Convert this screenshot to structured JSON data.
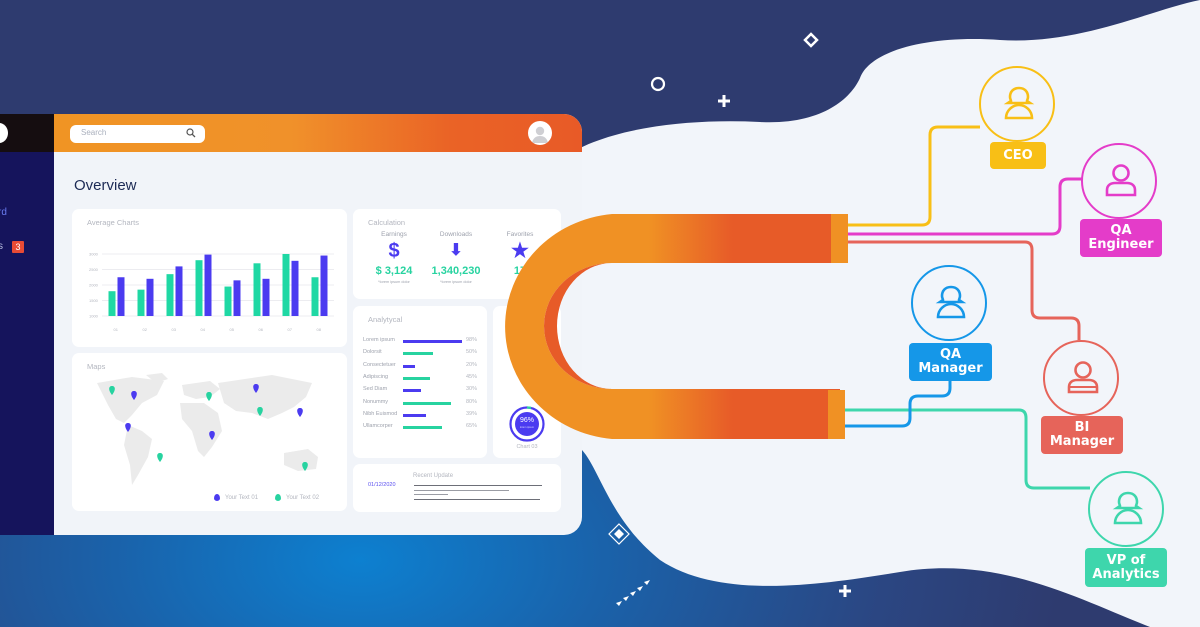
{
  "dashboard": {
    "sidebar": {
      "items": [
        {
          "label": "rd"
        },
        {
          "label": "s",
          "badge": "3"
        }
      ]
    },
    "header": {
      "search_placeholder": "Search",
      "search_icon": "search-icon",
      "avatar_icon": "user-avatar-icon"
    },
    "page_title": "Overview",
    "average_charts": {
      "title": "Average Charts"
    },
    "calculation": {
      "title": "Calculation",
      "items": [
        {
          "label": "Earnings",
          "icon": "dollar-icon",
          "glyph": "$",
          "value": "$ 3,124",
          "sub": "*lorem ipsum dolor"
        },
        {
          "label": "Downloads",
          "icon": "download-arrow-icon",
          "glyph": "⬇",
          "value": "1,340,230",
          "sub": "*lorem ipsum dolor"
        },
        {
          "label": "Favorites",
          "icon": "star-icon",
          "glyph": "★",
          "value": "17",
          "sub": ""
        }
      ]
    },
    "analytical": {
      "title": "Analytycal",
      "rows": [
        {
          "label": "Lorem ipsum",
          "percent": 98,
          "pct_text": "98%",
          "color": "#4b3bf0"
        },
        {
          "label": "Dolorsit",
          "percent": 50,
          "pct_text": "50%",
          "color": "#27d3a0"
        },
        {
          "label": "Consectetuer",
          "percent": 20,
          "pct_text": "20%",
          "color": "#4b3bf0"
        },
        {
          "label": "Adipiscing",
          "percent": 45,
          "pct_text": "45%",
          "color": "#27d3a0"
        },
        {
          "label": "Sed Diam",
          "percent": 30,
          "pct_text": "30%",
          "color": "#4b3bf0"
        },
        {
          "label": "Nonummy",
          "percent": 80,
          "pct_text": "80%",
          "color": "#27d3a0"
        },
        {
          "label": "Nibh Euismod",
          "percent": 39,
          "pct_text": "39%",
          "color": "#4b3bf0"
        },
        {
          "label": "Ullamcorper",
          "percent": 65,
          "pct_text": "65%",
          "color": "#27d3a0"
        }
      ]
    },
    "chart03": {
      "label": "Chart 03",
      "value_text": "96%",
      "value": 96,
      "sub": "lorem ipsum"
    },
    "maps": {
      "title": "Maps",
      "legend": [
        {
          "label": "Your Text 01",
          "color": "#4b3bf0"
        },
        {
          "label": "Your Text 02",
          "color": "#27d3a0"
        }
      ]
    },
    "recent_update": {
      "title": "Recent Update",
      "date": "01/12/2020"
    }
  },
  "chart_data": {
    "type": "bar",
    "title": "Average Charts",
    "categories": [
      "01",
      "02",
      "03",
      "04",
      "05",
      "06",
      "07",
      "08"
    ],
    "series": [
      {
        "name": "series-green",
        "color": "#1fd8a4",
        "values": [
          1800,
          1850,
          2350,
          2800,
          1950,
          2700,
          3000,
          2250
        ]
      },
      {
        "name": "series-blue",
        "color": "#4b3bf0",
        "values": [
          2250,
          2200,
          2600,
          2980,
          2150,
          2200,
          2780,
          2950
        ]
      }
    ],
    "yticks": [
      "1000",
      "1500",
      "2000",
      "2500",
      "3000"
    ],
    "ylim": [
      1000,
      3000
    ],
    "xlabel": "",
    "ylabel": "",
    "grid": true
  },
  "roles": [
    {
      "id": "ceo",
      "label": "CEO",
      "color": "#f8bf16",
      "icon": "female-user-icon"
    },
    {
      "id": "qa-engineer",
      "label": "QA\nEngineer",
      "color": "#e43cc9",
      "icon": "male-user-icon"
    },
    {
      "id": "qa-manager",
      "label": "QA\nManager",
      "color": "#1597e8",
      "icon": "female-user-icon"
    },
    {
      "id": "bi-manager",
      "label": "BI\nManager",
      "color": "#e6645a",
      "icon": "male-user-icon"
    },
    {
      "id": "vp-analytics",
      "label": "VP of\nAnalytics",
      "color": "#3ed6ac",
      "icon": "female-user-icon"
    }
  ],
  "magnet": {
    "colors": [
      "#f09124",
      "#e75b28"
    ]
  }
}
